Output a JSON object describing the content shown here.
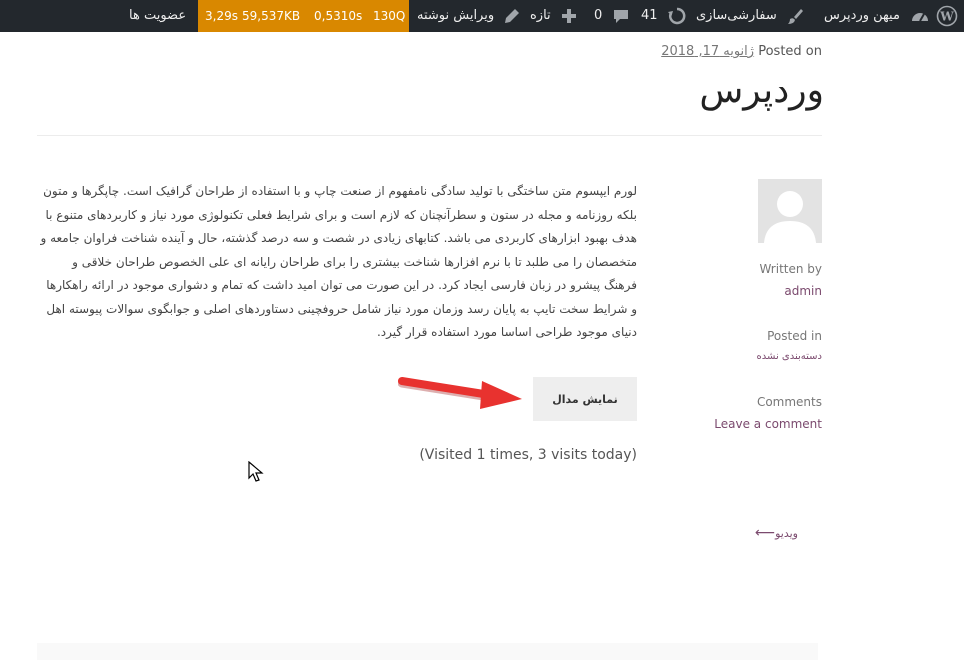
{
  "adminbar": {
    "site_name": "میهن وردپرس",
    "customize": "سفارشی‌سازی",
    "updates_count": "41",
    "comments_count": "0",
    "new_label": "تازه",
    "edit_post": "ویرایش نوشته",
    "debug": {
      "queries": "130Q",
      "time1": "0,5310s",
      "memory": "59,537KB",
      "time2": "3,29s"
    },
    "membership": "عضویت ها"
  },
  "post": {
    "posted_on_prefix": "Posted on",
    "date": "ژانویه 17, 2018",
    "title": "وردپرس",
    "body": "لورم ایپسوم متن ساختگی با تولید سادگی نامفهوم از صنعت چاپ و با استفاده از طراحان گرافیک است. چاپگرها و متون بلکه روزنامه و مجله در ستون و سطرآنچنان که لازم است و برای شرایط فعلی تکنولوژی مورد نیاز و کاربردهای متنوع با هدف بهبود ابزارهای کاربردی می باشد. کتابهای زیادی در شصت و سه درصد گذشته، حال و آینده شناخت فراوان جامعه و متخصصان را می طلبد تا با نرم افزارها شناخت بیشتری را برای طراحان رایانه ای علی الخصوص طراحان خلاقی و فرهنگ پیشرو در زبان فارسی ایجاد کرد. در این صورت می توان امید داشت که تمام و دشواری موجود در ارائه راهکارها و شرایط سخت تایپ به پایان رسد وزمان مورد نیاز شامل حروفچینی دستاوردهای اصلی و جوابگوی سوالات پیوسته اهل دنیای موجود طراحی اساسا مورد استفاده قرار گیرد.",
    "button_label": "نمایش مدال",
    "visits": "(Visited 1 times, 3 visits today)"
  },
  "meta": {
    "written_by_label": "Written by",
    "author": "admin",
    "posted_in_label": "Posted in",
    "category": "دسته‌بندی نشده",
    "comments_label": "Comments",
    "leave_comment": "Leave a comment"
  },
  "nav": {
    "prev_arrow": "⟵",
    "prev_title": "ویدیو"
  },
  "colors": {
    "adminbar_bg": "#23282d",
    "debug_bg": "#d98800",
    "link": "#7b4a6e",
    "arrow": "#e8322f"
  }
}
